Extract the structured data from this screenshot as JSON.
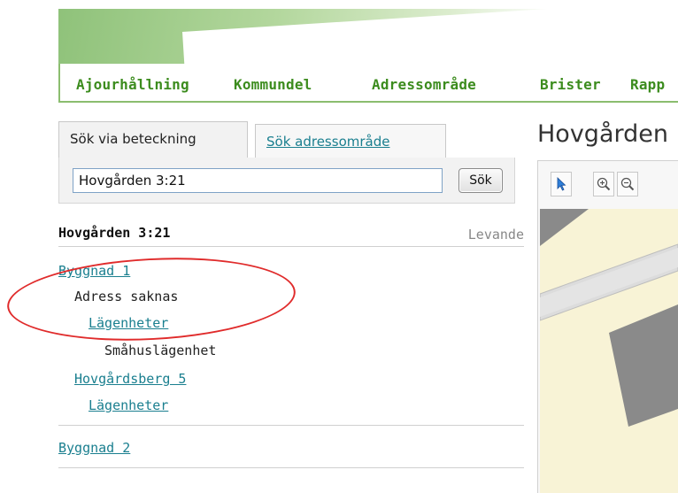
{
  "nav": {
    "items": [
      "Ajourhållning",
      "Kommundel",
      "Adressområde",
      "Brister",
      "Rapp"
    ]
  },
  "search": {
    "tabs": {
      "active": "Sök via beteckning",
      "inactive": "Sök adressområde"
    },
    "input_value": "Hovgården 3:21",
    "button_label": "Sök"
  },
  "property": {
    "title": "Hovgården 3:21",
    "status": "Levande",
    "tree": {
      "building1": "Byggnad 1",
      "address_missing": "Adress saknas",
      "apartments1": "Lägenheter",
      "apartment_type": "Småhuslägenhet",
      "address": "Hovgårdsberg 5",
      "apartments2": "Lägenheter",
      "building2": "Byggnad 2"
    }
  },
  "map": {
    "title": "Hovgården",
    "tools": [
      "pointer-icon",
      "zoom-in-icon",
      "zoom-out-icon"
    ]
  },
  "colors": {
    "nav_text": "#3c8c1e",
    "link": "#1a7f8f",
    "annotation": "#e02b2b",
    "banner": "#8fc27a"
  }
}
